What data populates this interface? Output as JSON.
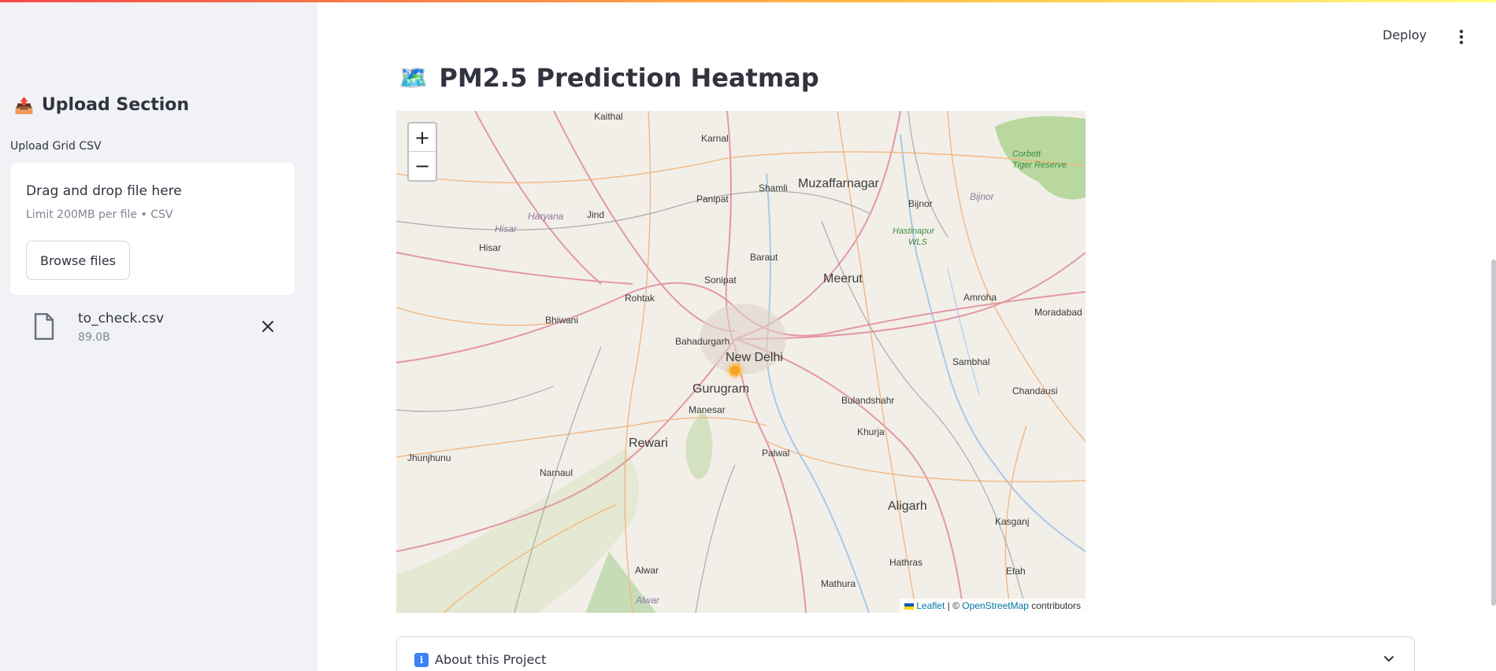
{
  "colors": {
    "accent": "#ff4b4b",
    "sidebar_bg": "#f0f2f6",
    "link": "#0078a8",
    "marker": "#f6a323"
  },
  "sidebar": {
    "section_emoji": "📤",
    "section_title": "Upload Section",
    "upload_label": "Upload Grid CSV",
    "dropzone": {
      "title": "Drag and drop file here",
      "subtitle": "Limit 200MB per file • CSV",
      "browse_label": "Browse files"
    },
    "file": {
      "icon": "file-icon",
      "name": "to_check.csv",
      "size": "89.0B"
    }
  },
  "header": {
    "deploy_label": "Deploy",
    "menu_icon": "vertical-dots-icon"
  },
  "main": {
    "title_emoji": "🗺️",
    "title": "PM2.5 Prediction Heatmap",
    "map": {
      "zoom_in": "+",
      "zoom_out": "−",
      "attribution": {
        "leaflet": "Leaflet",
        "separator": " | © ",
        "osm": "OpenStreetMap",
        "contributors": " contributors"
      },
      "labels": {
        "kaithal": "Kaithal",
        "karnal": "Karnal",
        "shamli": "Shamli",
        "muzaffarnagar": "Muzaffarnagar",
        "corbett": "Corbett",
        "tiger_reserve": "Tiger Reserve",
        "panipat": "Panipat",
        "bijnor": "Bijnor",
        "bijnor2": "Bijnor",
        "haryana": "Haryana",
        "jind": "Jind",
        "hisar": "Hisar",
        "hisar2": "Hisar",
        "hastinapur": "Hastinapur",
        "wls": "WLS",
        "baraut": "Baraut",
        "sonipat": "Sonipat",
        "meerut": "Meerut",
        "rohtak": "Rohtak",
        "amroha": "Amroha",
        "moradabad": "Moradabad",
        "bhiwani": "Bhiwani",
        "bahadurgarh": "Bahadurgarh",
        "new_delhi": "New Delhi",
        "sambhal": "Sambhal",
        "gurugram": "Gurugram",
        "chandausi": "Chandausi",
        "bulandshahr": "Bulandshahr",
        "manesar": "Manesar",
        "khurja": "Khurja",
        "rewari": "Rewari",
        "jhunjhunu": "Jhunjhunu",
        "palwal": "Palwal",
        "narnaul": "Narnaul",
        "aligarh": "Aligarh",
        "kasganj": "Kasganj",
        "hathras": "Hathras",
        "alwar": "Alwar",
        "alwar2": "Alwar",
        "etah": "Etah",
        "mathura": "Mathura"
      }
    },
    "expander": {
      "icon": "info-icon",
      "icon_glyph": "i",
      "label": "About this Project"
    }
  }
}
